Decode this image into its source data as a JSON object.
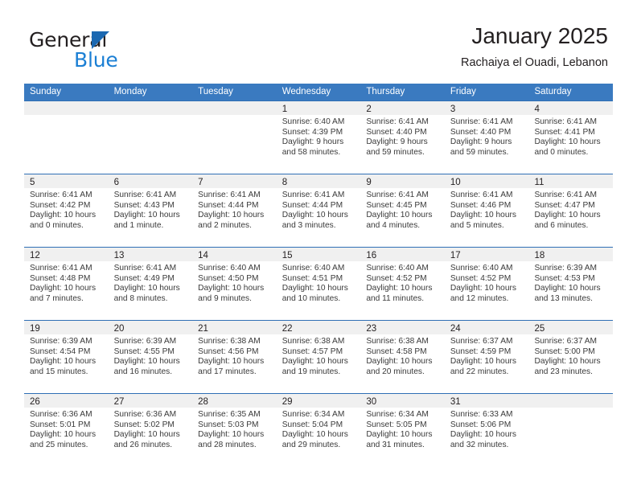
{
  "brand": {
    "name_part1": "General",
    "name_part2": "Blue",
    "triangle_color": "#1b68b1",
    "blue_text_color": "#1b7fd4"
  },
  "header": {
    "title": "January 2025",
    "subtitle": "Rachaiya el Ouadi, Lebanon",
    "header_bg_color": "#3a7ac0",
    "header_text_color": "#ffffff"
  },
  "calendar": {
    "weekday_headers": [
      "Sunday",
      "Monday",
      "Tuesday",
      "Wednesday",
      "Thursday",
      "Friday",
      "Saturday"
    ],
    "weeks": [
      [
        {
          "day": "",
          "sunrise": "",
          "sunset": "",
          "daylight_line1": "",
          "daylight_line2": ""
        },
        {
          "day": "",
          "sunrise": "",
          "sunset": "",
          "daylight_line1": "",
          "daylight_line2": ""
        },
        {
          "day": "",
          "sunrise": "",
          "sunset": "",
          "daylight_line1": "",
          "daylight_line2": ""
        },
        {
          "day": "1",
          "sunrise": "Sunrise: 6:40 AM",
          "sunset": "Sunset: 4:39 PM",
          "daylight_line1": "Daylight: 9 hours",
          "daylight_line2": "and 58 minutes."
        },
        {
          "day": "2",
          "sunrise": "Sunrise: 6:41 AM",
          "sunset": "Sunset: 4:40 PM",
          "daylight_line1": "Daylight: 9 hours",
          "daylight_line2": "and 59 minutes."
        },
        {
          "day": "3",
          "sunrise": "Sunrise: 6:41 AM",
          "sunset": "Sunset: 4:40 PM",
          "daylight_line1": "Daylight: 9 hours",
          "daylight_line2": "and 59 minutes."
        },
        {
          "day": "4",
          "sunrise": "Sunrise: 6:41 AM",
          "sunset": "Sunset: 4:41 PM",
          "daylight_line1": "Daylight: 10 hours",
          "daylight_line2": "and 0 minutes."
        }
      ],
      [
        {
          "day": "5",
          "sunrise": "Sunrise: 6:41 AM",
          "sunset": "Sunset: 4:42 PM",
          "daylight_line1": "Daylight: 10 hours",
          "daylight_line2": "and 0 minutes."
        },
        {
          "day": "6",
          "sunrise": "Sunrise: 6:41 AM",
          "sunset": "Sunset: 4:43 PM",
          "daylight_line1": "Daylight: 10 hours",
          "daylight_line2": "and 1 minute."
        },
        {
          "day": "7",
          "sunrise": "Sunrise: 6:41 AM",
          "sunset": "Sunset: 4:44 PM",
          "daylight_line1": "Daylight: 10 hours",
          "daylight_line2": "and 2 minutes."
        },
        {
          "day": "8",
          "sunrise": "Sunrise: 6:41 AM",
          "sunset": "Sunset: 4:44 PM",
          "daylight_line1": "Daylight: 10 hours",
          "daylight_line2": "and 3 minutes."
        },
        {
          "day": "9",
          "sunrise": "Sunrise: 6:41 AM",
          "sunset": "Sunset: 4:45 PM",
          "daylight_line1": "Daylight: 10 hours",
          "daylight_line2": "and 4 minutes."
        },
        {
          "day": "10",
          "sunrise": "Sunrise: 6:41 AM",
          "sunset": "Sunset: 4:46 PM",
          "daylight_line1": "Daylight: 10 hours",
          "daylight_line2": "and 5 minutes."
        },
        {
          "day": "11",
          "sunrise": "Sunrise: 6:41 AM",
          "sunset": "Sunset: 4:47 PM",
          "daylight_line1": "Daylight: 10 hours",
          "daylight_line2": "and 6 minutes."
        }
      ],
      [
        {
          "day": "12",
          "sunrise": "Sunrise: 6:41 AM",
          "sunset": "Sunset: 4:48 PM",
          "daylight_line1": "Daylight: 10 hours",
          "daylight_line2": "and 7 minutes."
        },
        {
          "day": "13",
          "sunrise": "Sunrise: 6:41 AM",
          "sunset": "Sunset: 4:49 PM",
          "daylight_line1": "Daylight: 10 hours",
          "daylight_line2": "and 8 minutes."
        },
        {
          "day": "14",
          "sunrise": "Sunrise: 6:40 AM",
          "sunset": "Sunset: 4:50 PM",
          "daylight_line1": "Daylight: 10 hours",
          "daylight_line2": "and 9 minutes."
        },
        {
          "day": "15",
          "sunrise": "Sunrise: 6:40 AM",
          "sunset": "Sunset: 4:51 PM",
          "daylight_line1": "Daylight: 10 hours",
          "daylight_line2": "and 10 minutes."
        },
        {
          "day": "16",
          "sunrise": "Sunrise: 6:40 AM",
          "sunset": "Sunset: 4:52 PM",
          "daylight_line1": "Daylight: 10 hours",
          "daylight_line2": "and 11 minutes."
        },
        {
          "day": "17",
          "sunrise": "Sunrise: 6:40 AM",
          "sunset": "Sunset: 4:52 PM",
          "daylight_line1": "Daylight: 10 hours",
          "daylight_line2": "and 12 minutes."
        },
        {
          "day": "18",
          "sunrise": "Sunrise: 6:39 AM",
          "sunset": "Sunset: 4:53 PM",
          "daylight_line1": "Daylight: 10 hours",
          "daylight_line2": "and 13 minutes."
        }
      ],
      [
        {
          "day": "19",
          "sunrise": "Sunrise: 6:39 AM",
          "sunset": "Sunset: 4:54 PM",
          "daylight_line1": "Daylight: 10 hours",
          "daylight_line2": "and 15 minutes."
        },
        {
          "day": "20",
          "sunrise": "Sunrise: 6:39 AM",
          "sunset": "Sunset: 4:55 PM",
          "daylight_line1": "Daylight: 10 hours",
          "daylight_line2": "and 16 minutes."
        },
        {
          "day": "21",
          "sunrise": "Sunrise: 6:38 AM",
          "sunset": "Sunset: 4:56 PM",
          "daylight_line1": "Daylight: 10 hours",
          "daylight_line2": "and 17 minutes."
        },
        {
          "day": "22",
          "sunrise": "Sunrise: 6:38 AM",
          "sunset": "Sunset: 4:57 PM",
          "daylight_line1": "Daylight: 10 hours",
          "daylight_line2": "and 19 minutes."
        },
        {
          "day": "23",
          "sunrise": "Sunrise: 6:38 AM",
          "sunset": "Sunset: 4:58 PM",
          "daylight_line1": "Daylight: 10 hours",
          "daylight_line2": "and 20 minutes."
        },
        {
          "day": "24",
          "sunrise": "Sunrise: 6:37 AM",
          "sunset": "Sunset: 4:59 PM",
          "daylight_line1": "Daylight: 10 hours",
          "daylight_line2": "and 22 minutes."
        },
        {
          "day": "25",
          "sunrise": "Sunrise: 6:37 AM",
          "sunset": "Sunset: 5:00 PM",
          "daylight_line1": "Daylight: 10 hours",
          "daylight_line2": "and 23 minutes."
        }
      ],
      [
        {
          "day": "26",
          "sunrise": "Sunrise: 6:36 AM",
          "sunset": "Sunset: 5:01 PM",
          "daylight_line1": "Daylight: 10 hours",
          "daylight_line2": "and 25 minutes."
        },
        {
          "day": "27",
          "sunrise": "Sunrise: 6:36 AM",
          "sunset": "Sunset: 5:02 PM",
          "daylight_line1": "Daylight: 10 hours",
          "daylight_line2": "and 26 minutes."
        },
        {
          "day": "28",
          "sunrise": "Sunrise: 6:35 AM",
          "sunset": "Sunset: 5:03 PM",
          "daylight_line1": "Daylight: 10 hours",
          "daylight_line2": "and 28 minutes."
        },
        {
          "day": "29",
          "sunrise": "Sunrise: 6:34 AM",
          "sunset": "Sunset: 5:04 PM",
          "daylight_line1": "Daylight: 10 hours",
          "daylight_line2": "and 29 minutes."
        },
        {
          "day": "30",
          "sunrise": "Sunrise: 6:34 AM",
          "sunset": "Sunset: 5:05 PM",
          "daylight_line1": "Daylight: 10 hours",
          "daylight_line2": "and 31 minutes."
        },
        {
          "day": "31",
          "sunrise": "Sunrise: 6:33 AM",
          "sunset": "Sunset: 5:06 PM",
          "daylight_line1": "Daylight: 10 hours",
          "daylight_line2": "and 32 minutes."
        },
        {
          "day": "",
          "sunrise": "",
          "sunset": "",
          "daylight_line1": "",
          "daylight_line2": ""
        }
      ]
    ]
  }
}
